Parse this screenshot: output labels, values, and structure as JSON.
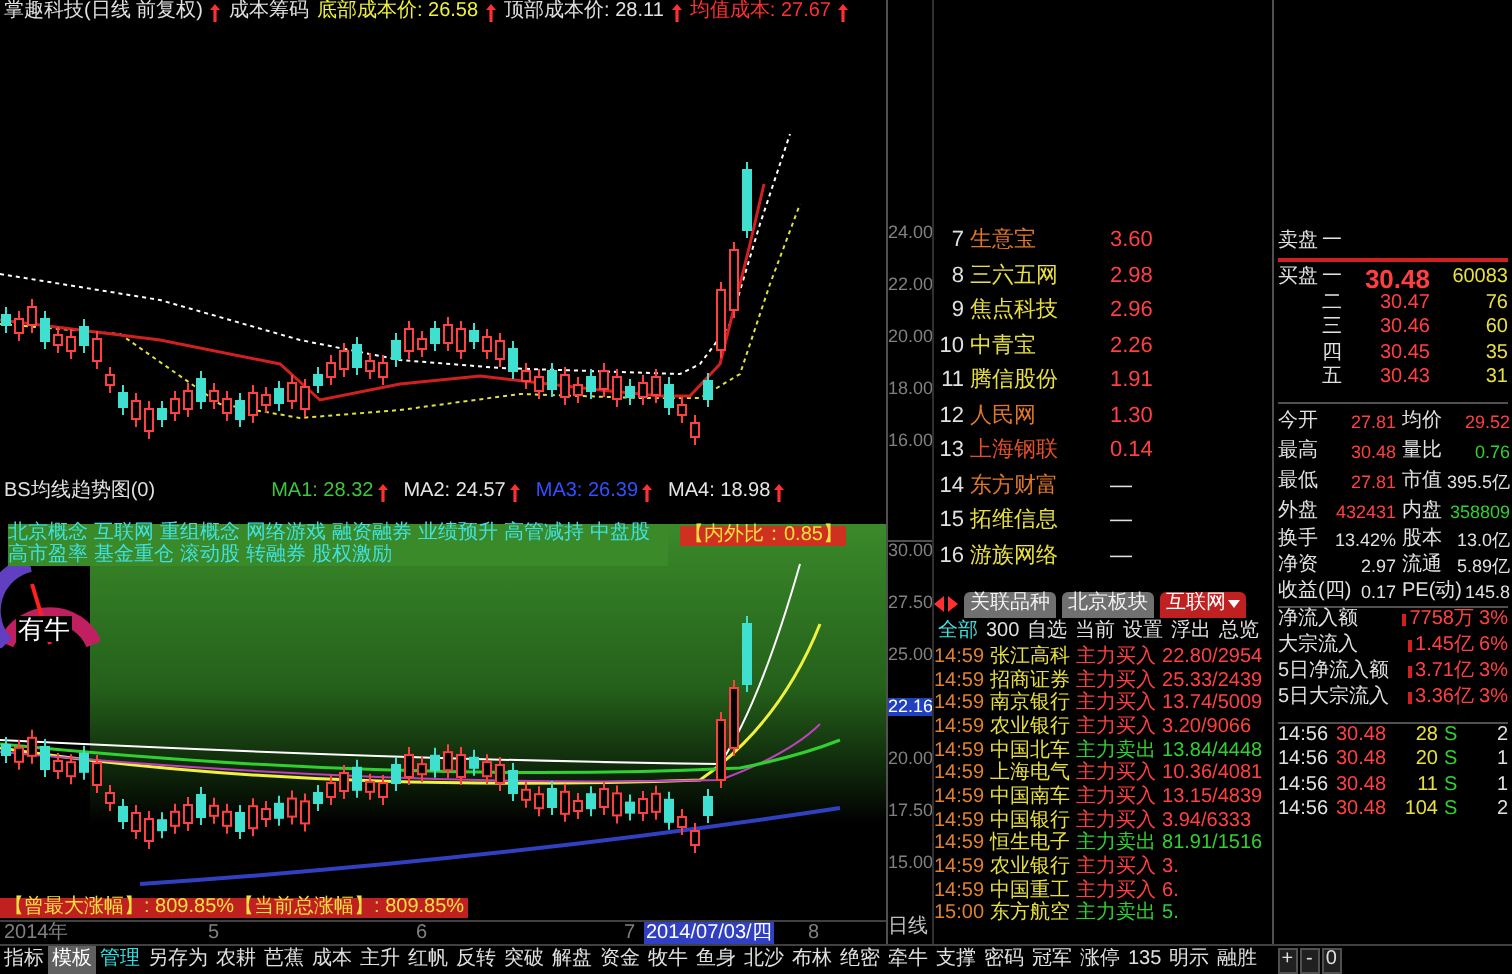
{
  "header": {
    "title": "掌趣科技(日线 前复权)",
    "cost_label": "成本筹码",
    "bottom_cost": "底部成本价: 26.58",
    "top_cost": "顶部成本价: 28.11",
    "avg_cost": "均值成本: 27.67"
  },
  "main_axis": [
    "24.00",
    "22.00",
    "20.00",
    "18.00",
    "16.00"
  ],
  "indicator": {
    "title": "BS均线趋势图(0)",
    "ma": [
      {
        "label": "MA1: 28.32",
        "color": "#3ec43e"
      },
      {
        "label": "MA2: 24.57",
        "color": "#e5e5e5"
      },
      {
        "label": "MA3: 26.39",
        "color": "#3050ff"
      },
      {
        "label": "MA4: 18.98",
        "color": "#e5e5e5"
      }
    ]
  },
  "lower_chart": {
    "concepts": [
      "北京概念",
      "互联网",
      "重组概念",
      "网络游戏",
      "融资融券",
      "业绩预升",
      "高管减持",
      "中盘股",
      "高市盈率",
      "基金重仓",
      "滚动股",
      "转融券",
      "股权激励"
    ],
    "ratio": "【内外比：0.85】",
    "gauge_text": "有牛"
  },
  "lower_axis": [
    {
      "label": "30.00",
      "selected": false
    },
    {
      "label": "27.50",
      "selected": false
    },
    {
      "label": "25.00",
      "selected": false
    },
    {
      "label": "22.16",
      "selected": true
    },
    {
      "label": "20.00",
      "selected": false
    },
    {
      "label": "17.50",
      "selected": false
    },
    {
      "label": "15.00",
      "selected": false
    }
  ],
  "gain_note": "【曾最大涨幅】: 809.85%【当前总涨幅】: 809.85%",
  "date_axis": [
    {
      "label": "2014年",
      "selected": false
    },
    {
      "label": "5",
      "selected": false
    },
    {
      "label": "6",
      "selected": false
    },
    {
      "label": "7",
      "selected": false
    },
    {
      "label": "2014/07/03/四",
      "selected": true
    },
    {
      "label": "8",
      "selected": false
    }
  ],
  "period": "日线",
  "zoom_buttons": [
    "+",
    "-",
    "0"
  ],
  "toolbar": [
    {
      "label": "指标",
      "selected": false,
      "accent": false
    },
    {
      "label": "模板",
      "selected": true,
      "accent": false
    },
    {
      "label": "管理",
      "selected": false,
      "accent": true
    },
    {
      "label": "另存为",
      "selected": false,
      "accent": false
    },
    {
      "label": "农耕",
      "selected": false,
      "accent": false
    },
    {
      "label": "芭蕉",
      "selected": false,
      "accent": false
    },
    {
      "label": "成本",
      "selected": false,
      "accent": false
    },
    {
      "label": "主升",
      "selected": false,
      "accent": false
    },
    {
      "label": "红帆",
      "selected": false,
      "accent": false
    },
    {
      "label": "反转",
      "selected": false,
      "accent": false
    },
    {
      "label": "突破",
      "selected": false,
      "accent": false
    },
    {
      "label": "解盘",
      "selected": false,
      "accent": false
    },
    {
      "label": "资金",
      "selected": false,
      "accent": false
    },
    {
      "label": "牧牛",
      "selected": false,
      "accent": false
    },
    {
      "label": "鱼身",
      "selected": false,
      "accent": false
    },
    {
      "label": "北沙",
      "selected": false,
      "accent": false
    },
    {
      "label": "布林",
      "selected": false,
      "accent": false
    },
    {
      "label": "绝密",
      "selected": false,
      "accent": false
    },
    {
      "label": "牵牛",
      "selected": false,
      "accent": false
    },
    {
      "label": "支撑",
      "selected": false,
      "accent": false
    },
    {
      "label": "密码",
      "selected": false,
      "accent": false
    },
    {
      "label": "冠军",
      "selected": false,
      "accent": false
    },
    {
      "label": "涨停",
      "selected": false,
      "accent": false
    },
    {
      "label": "135",
      "selected": false,
      "accent": false
    },
    {
      "label": "明示",
      "selected": false,
      "accent": false
    },
    {
      "label": "融胜",
      "selected": false,
      "accent": false
    }
  ],
  "rank_list": [
    {
      "rank": "7",
      "name": "生意宝",
      "value": "3.60",
      "color": "#e07828",
      "rising": true
    },
    {
      "rank": "8",
      "name": "三六五网",
      "value": "2.98",
      "color": "#e8e040",
      "rising": true
    },
    {
      "rank": "9",
      "name": "焦点科技",
      "value": "2.96",
      "color": "#e8e040",
      "rising": true
    },
    {
      "rank": "10",
      "name": "中青宝",
      "value": "2.26",
      "color": "#e8e040",
      "rising": true
    },
    {
      "rank": "11",
      "name": "腾信股份",
      "value": "1.91",
      "color": "#e8e040",
      "rising": true
    },
    {
      "rank": "12",
      "name": "人民网",
      "value": "1.30",
      "color": "#e07828",
      "rising": true
    },
    {
      "rank": "13",
      "name": "上海钢联",
      "value": "0.14",
      "color": "#e05028",
      "rising": true
    },
    {
      "rank": "14",
      "name": "东方财富",
      "value": "—",
      "color": "#e07828",
      "rising": false
    },
    {
      "rank": "15",
      "name": "拓维信息",
      "value": "—",
      "color": "#e8e040",
      "rising": false
    },
    {
      "rank": "16",
      "name": "游族网络",
      "value": "—",
      "color": "#e8e040",
      "rising": false
    }
  ],
  "sector_tabs": [
    {
      "label": "关联品种",
      "selected": false
    },
    {
      "label": "北京板块",
      "selected": false
    },
    {
      "label": "互联网",
      "selected": true
    }
  ],
  "filter_tabs": [
    {
      "label": "全部",
      "selected": true
    },
    {
      "label": "300",
      "selected": false
    },
    {
      "label": "自选",
      "selected": false
    },
    {
      "label": "当前",
      "selected": false
    },
    {
      "label": "设置",
      "selected": false
    },
    {
      "label": "浮出",
      "selected": false
    },
    {
      "label": "总览",
      "selected": false
    }
  ],
  "trades": [
    {
      "time": "14:59",
      "name": "张江高科",
      "action": "主力买入",
      "detail": "22.80/2954",
      "kind": "buy"
    },
    {
      "time": "14:59",
      "name": "招商证券",
      "action": "主力买入",
      "detail": "25.33/2439",
      "kind": "buy"
    },
    {
      "time": "14:59",
      "name": "南京银行",
      "action": "主力买入",
      "detail": "13.74/5009",
      "kind": "buy"
    },
    {
      "time": "14:59",
      "name": "农业银行",
      "action": "主力买入",
      "detail": "3.20/9066",
      "kind": "buy"
    },
    {
      "time": "14:59",
      "name": "中国北车",
      "action": "主力卖出",
      "detail": "13.84/4448",
      "kind": "sell"
    },
    {
      "time": "14:59",
      "name": "上海电气",
      "action": "主力买入",
      "detail": "10.36/4081",
      "kind": "buy"
    },
    {
      "time": "14:59",
      "name": "中国南车",
      "action": "主力买入",
      "detail": "13.15/4839",
      "kind": "buy"
    },
    {
      "time": "14:59",
      "name": "中国银行",
      "action": "主力买入",
      "detail": "3.94/6333",
      "kind": "buy"
    },
    {
      "time": "14:59",
      "name": "恒生电子",
      "action": "主力卖出",
      "detail": "81.91/1516",
      "kind": "sell"
    },
    {
      "time": "14:59",
      "name": "农业银行",
      "action": "主力买入",
      "detail": "3.",
      "kind": "buy"
    },
    {
      "time": "14:59",
      "name": "中国重工",
      "action": "主力买入",
      "detail": "6.",
      "kind": "buy"
    },
    {
      "time": "15:00",
      "name": "东方航空",
      "action": "主力卖出",
      "detail": "5.",
      "kind": "sell"
    }
  ],
  "order_book": {
    "sell_label": "卖盘",
    "sell": [
      {
        "level": "一"
      }
    ],
    "buy_label": "买盘",
    "buy": [
      {
        "level": "一",
        "price": "30.48",
        "volume": "60083"
      },
      {
        "level": "二",
        "price": "30.47",
        "volume": "76"
      },
      {
        "level": "三",
        "price": "30.46",
        "volume": "60"
      },
      {
        "level": "四",
        "price": "30.45",
        "volume": "35"
      },
      {
        "level": "五",
        "price": "30.43",
        "volume": "31"
      }
    ]
  },
  "stats": [
    {
      "label": "今开",
      "value": "27.81",
      "color": "#ff4040"
    },
    {
      "label": "均价",
      "value": "29.52",
      "color": "#ff4040"
    },
    {
      "label": "最高",
      "value": "30.48",
      "color": "#ff4040"
    },
    {
      "label": "量比",
      "value": "0.76",
      "color": "#30d030"
    },
    {
      "label": "最低",
      "value": "27.81",
      "color": "#ff4040"
    },
    {
      "label": "市值",
      "value": "395.5亿",
      "color": "#e0e0e0"
    },
    {
      "label": "外盘",
      "value": "432431",
      "color": "#ff4040"
    },
    {
      "label": "内盘",
      "value": "358809",
      "color": "#30d030"
    },
    {
      "label": "换手",
      "value": "13.42%",
      "color": "#e0e0e0"
    },
    {
      "label": "股本",
      "value": "13.0亿",
      "color": "#e0e0e0"
    },
    {
      "label": "净资",
      "value": "2.97",
      "color": "#e0e0e0"
    },
    {
      "label": "流通",
      "value": "5.89亿",
      "color": "#e0e0e0"
    },
    {
      "label": "收益(四)",
      "value": "0.17",
      "color": "#e0e0e0"
    },
    {
      "label": "PE(动)",
      "value": "145.8",
      "color": "#e0e0e0"
    }
  ],
  "flows": [
    {
      "label": "净流入额",
      "value": "7758万",
      "pct": "3%"
    },
    {
      "label": "大宗流入",
      "value": "1.45亿",
      "pct": "6%"
    },
    {
      "label": "5日净流入额",
      "value": "3.71亿",
      "pct": "3%"
    },
    {
      "label": "5日大宗流入",
      "value": "3.36亿",
      "pct": "3%"
    }
  ],
  "ticks": [
    {
      "time": "14:56",
      "price": "30.48",
      "volume": "28",
      "side": "S",
      "count": "2"
    },
    {
      "time": "14:56",
      "price": "30.48",
      "volume": "20",
      "side": "S",
      "count": "1"
    },
    {
      "time": "14:56",
      "price": "30.48",
      "volume": "11",
      "side": "S",
      "count": "1"
    },
    {
      "time": "14:56",
      "price": "30.48",
      "volume": "104",
      "side": "S",
      "count": "2"
    }
  ]
}
